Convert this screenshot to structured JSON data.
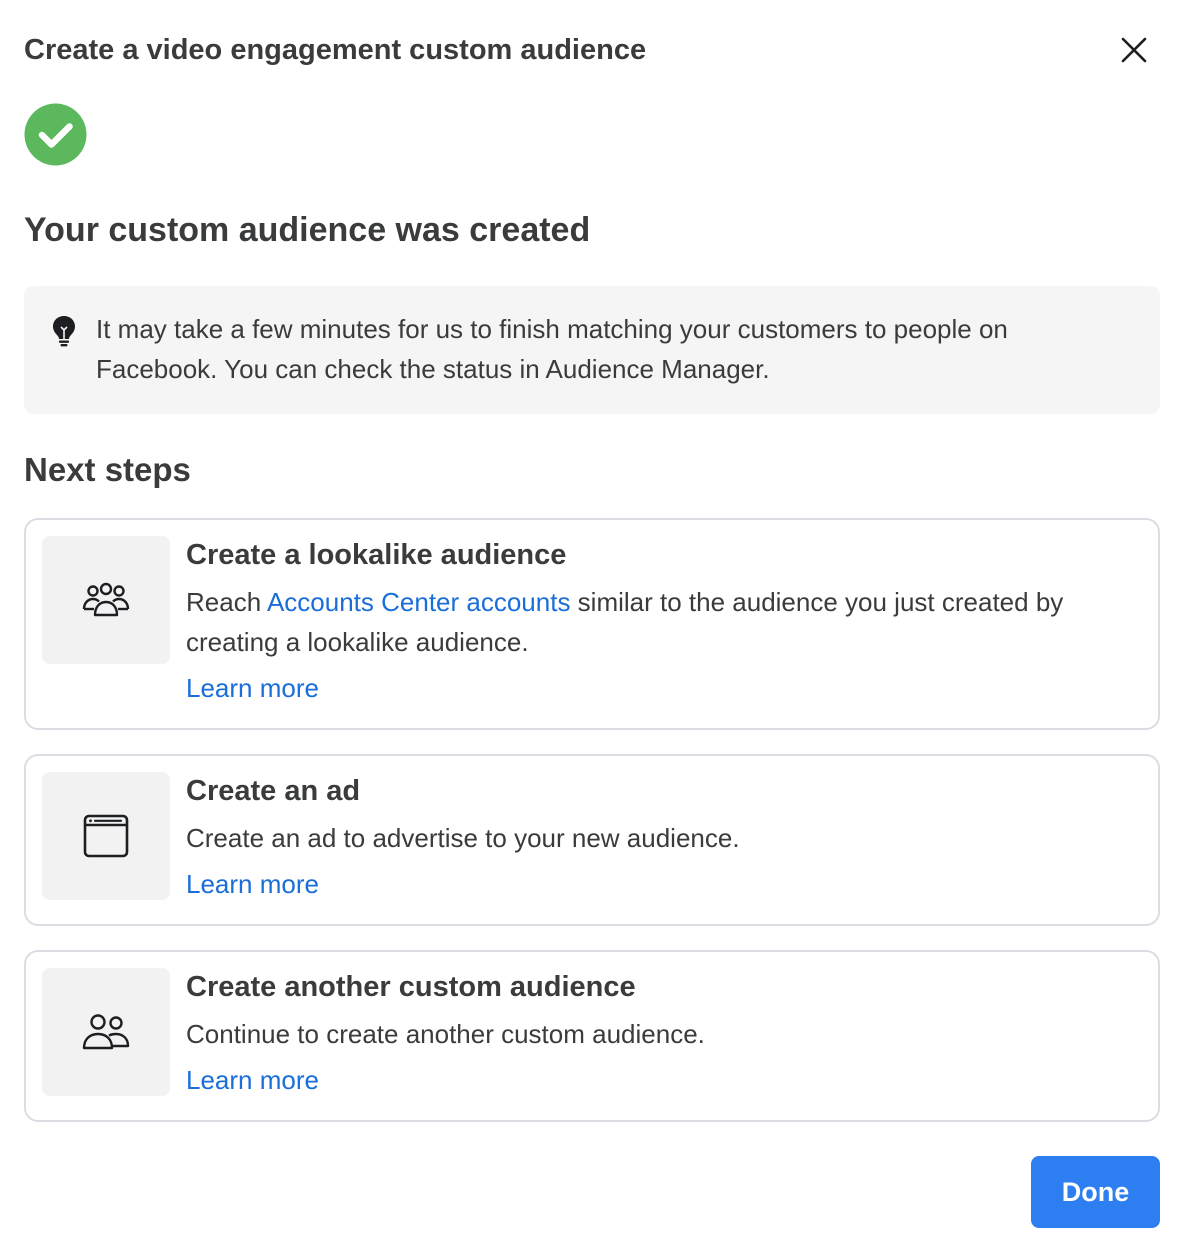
{
  "dialog": {
    "title": "Create a video engagement custom audience",
    "close_icon": "close-icon"
  },
  "status": {
    "icon": "check-circle-icon",
    "icon_color": "#5cb85c",
    "headline": "Your custom audience was created"
  },
  "info": {
    "icon": "lightbulb-icon",
    "text": "It may take a few minutes for us to finish matching your customers to people on Facebook. You can check the status in Audience Manager."
  },
  "next_steps": {
    "title": "Next steps",
    "items": [
      {
        "icon": "people-group-icon",
        "title": "Create a lookalike audience",
        "desc_before": "Reach ",
        "desc_link": "Accounts Center accounts",
        "desc_after": " similar to the audience you just created by creating a lookalike audience.",
        "learn_more": "Learn more"
      },
      {
        "icon": "browser-window-icon",
        "title": "Create an ad",
        "desc": "Create an ad to advertise to your new audience.",
        "learn_more": "Learn more"
      },
      {
        "icon": "people-pair-icon",
        "title": "Create another custom audience",
        "desc": "Continue to create another custom audience.",
        "learn_more": "Learn more"
      }
    ]
  },
  "footer": {
    "done_label": "Done",
    "done_color": "#2d7ef0"
  },
  "colors": {
    "link": "#1a6ed8",
    "text": "#3a3b3c",
    "card_border": "#dadde1",
    "info_bg": "#f5f5f5"
  }
}
